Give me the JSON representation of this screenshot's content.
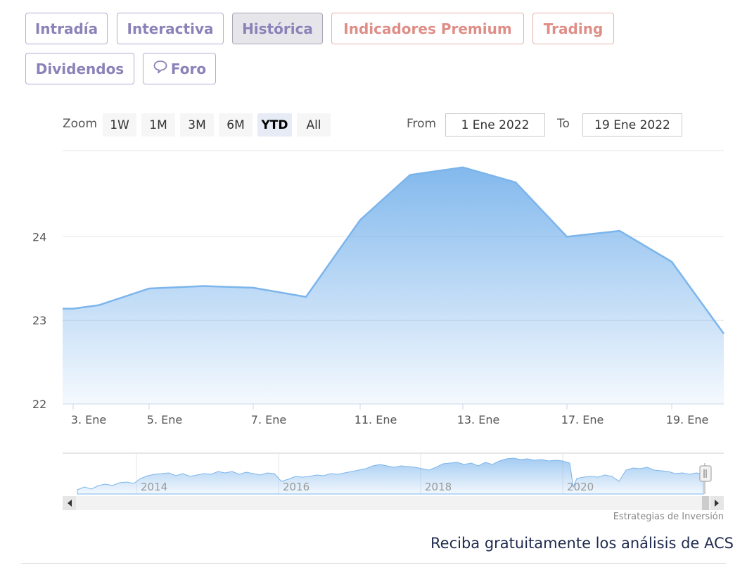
{
  "tabs": [
    {
      "label": "Intradía",
      "kind": "normal"
    },
    {
      "label": "Interactiva",
      "kind": "normal"
    },
    {
      "label": "Histórica",
      "kind": "active"
    },
    {
      "label": "Indicadores Premium",
      "kind": "premium"
    },
    {
      "label": "Trading",
      "kind": "premium"
    },
    {
      "label": "Dividendos",
      "kind": "normal"
    },
    {
      "label": "Foro",
      "kind": "normal",
      "icon": "chat-bubble-icon"
    }
  ],
  "zoom": {
    "label": "Zoom",
    "buttons": [
      "1W",
      "1M",
      "3M",
      "6M",
      "YTD",
      "All"
    ],
    "selected": "YTD"
  },
  "range": {
    "from_label": "From",
    "from_value": "1 Ene 2022",
    "to_label": "To",
    "to_value": "19 Ene 2022"
  },
  "chart_data": {
    "type": "area",
    "x": [
      "3. Ene",
      "4. Ene",
      "5. Ene",
      "6. Ene",
      "7. Ene",
      "10. Ene",
      "11. Ene",
      "12. Ene",
      "13. Ene",
      "14. Ene",
      "17. Ene",
      "18. Ene",
      "19. Ene",
      "20. Ene"
    ],
    "values": [
      23.14,
      23.18,
      23.38,
      23.41,
      23.39,
      23.28,
      24.2,
      24.74,
      24.83,
      24.65,
      24.0,
      24.07,
      23.7,
      22.84
    ],
    "x_tick_labels": [
      "3. Ene",
      "5. Ene",
      "7. Ene",
      "11. Ene",
      "13. Ene",
      "17. Ene",
      "19. Ene"
    ],
    "y_tick_labels": [
      "22",
      "23",
      "24"
    ],
    "ylim": [
      22,
      25.03
    ],
    "grid": true,
    "color": "#7cb5ec"
  },
  "navigator": {
    "year_labels": [
      "2014",
      "2016",
      "2018",
      "2020"
    ],
    "scroll_left_icon": "arrow-left-icon",
    "scroll_right_icon": "arrow-right-icon",
    "handle_icon": "grip-handle-icon"
  },
  "credit": "Estrategias de Inversión",
  "cta": "Reciba gratuitamente los análisis de ACS"
}
